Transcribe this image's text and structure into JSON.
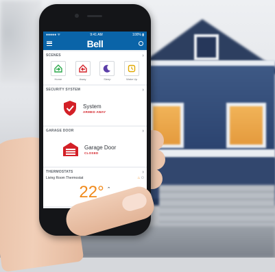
{
  "status_bar": {
    "carrier": "●●●●● ᯤ",
    "time": "9:41 AM",
    "battery": "100% ▮"
  },
  "app": {
    "brand": "Bell"
  },
  "scenes": {
    "header": "SCENES",
    "items": [
      {
        "label": "Home",
        "icon": "home-enter-icon",
        "color": "#2aa84a"
      },
      {
        "label": "Away",
        "icon": "home-exit-icon",
        "color": "#d32027"
      },
      {
        "label": "Sleep",
        "icon": "moon-icon",
        "color": "#5b3ea8"
      },
      {
        "label": "Wake Up",
        "icon": "alarm-icon",
        "color": "#e0a800"
      }
    ]
  },
  "security": {
    "header": "SECURITY SYSTEM",
    "title": "System",
    "status": "ARMED AWAY",
    "accent": "#d32027"
  },
  "garage": {
    "header": "GARAGE DOOR",
    "title": "Garage Door",
    "status": "CLOSED",
    "accent": "#d32027"
  },
  "thermostats": {
    "header": "THERMOSTATS",
    "name": "Living Room Thermostat",
    "temperature": "22°",
    "accent": "#f08a1c"
  }
}
